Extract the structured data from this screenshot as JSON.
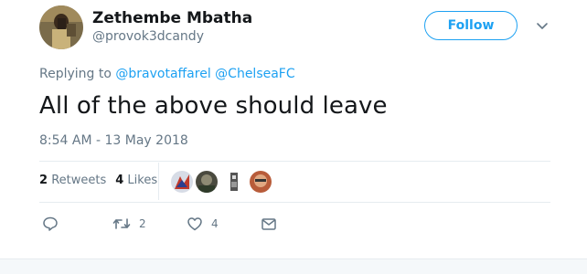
{
  "author": {
    "name": "Zethembe Mbatha",
    "handle": "@provok3dcandy",
    "avatar_icon": "profile-avatar"
  },
  "follow_label": "Follow",
  "replying": {
    "prefix": "Replying to",
    "mentions": [
      "@bravotaffarel",
      "@ChelseaFC"
    ]
  },
  "tweet_text": "All of the above should leave",
  "timestamp": "8:54 AM - 13 May 2018",
  "stats": {
    "retweets_count": "2",
    "retweets_label": "Retweets",
    "likes_count": "4",
    "likes_label": "Likes"
  },
  "actions": {
    "reply_count": "",
    "retweet_count": "2",
    "like_count": "4"
  },
  "colors": {
    "accent": "#1da1f2",
    "muted": "#657786",
    "text": "#14171a",
    "divider": "#e6ecf0"
  }
}
